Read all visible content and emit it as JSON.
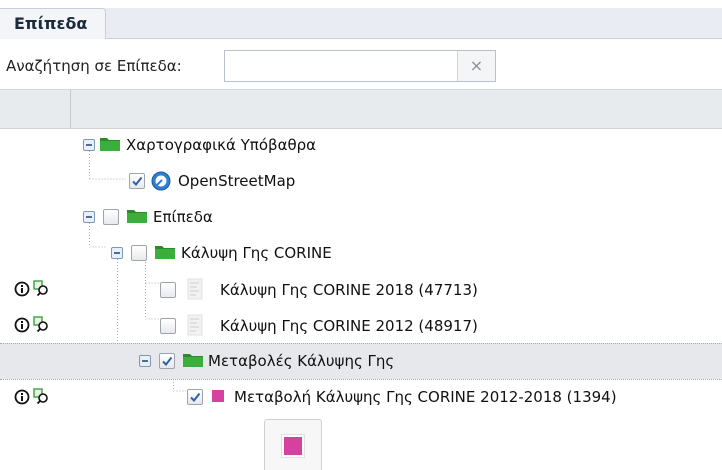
{
  "panel": {
    "tab_label": "Επίπεδα"
  },
  "search": {
    "label": "Αναζήτηση σε Επίπεδα:",
    "value": "",
    "placeholder": "",
    "clear_symbol": "×"
  },
  "colors": {
    "folder": "#3cae3c",
    "legend_swatch": "#d6409f",
    "selected_row": "#e6e8eb",
    "checkmark": "#2f5fb0"
  },
  "tree": [
    {
      "label": "Χαρτογραφικά Υπόβαθρα",
      "type": "folder",
      "expanded": true,
      "checkbox": false
    },
    {
      "label": "OpenStreetMap",
      "type": "layer",
      "icon": "osm-globe-icon",
      "checked": true
    },
    {
      "label": "Επίπεδα",
      "type": "folder",
      "expanded": true,
      "checked": false
    },
    {
      "label": "Κάλυψη Γης CORINE",
      "type": "folder",
      "expanded": true,
      "checked": false
    },
    {
      "label": "Κάλυψη Γης CORINE 2018 (47713)",
      "type": "layer",
      "icon": "document-icon",
      "checked": false,
      "actions": [
        "info-icon",
        "zoom-to-layer-icon"
      ]
    },
    {
      "label": "Κάλυψη Γης CORINE 2012 (48917)",
      "type": "layer",
      "icon": "document-icon",
      "checked": false,
      "actions": [
        "info-icon",
        "zoom-to-layer-icon"
      ]
    },
    {
      "label": "Μεταβολές Κάλυψης Γης",
      "type": "folder",
      "expanded": true,
      "checked": true,
      "selected": true
    },
    {
      "label": "Μεταβολή Κάλυψης Γης CORINE 2012-2018 (1394)",
      "type": "layer",
      "icon": "legend-swatch",
      "checked": true,
      "actions": [
        "info-icon",
        "zoom-to-layer-icon"
      ]
    }
  ]
}
